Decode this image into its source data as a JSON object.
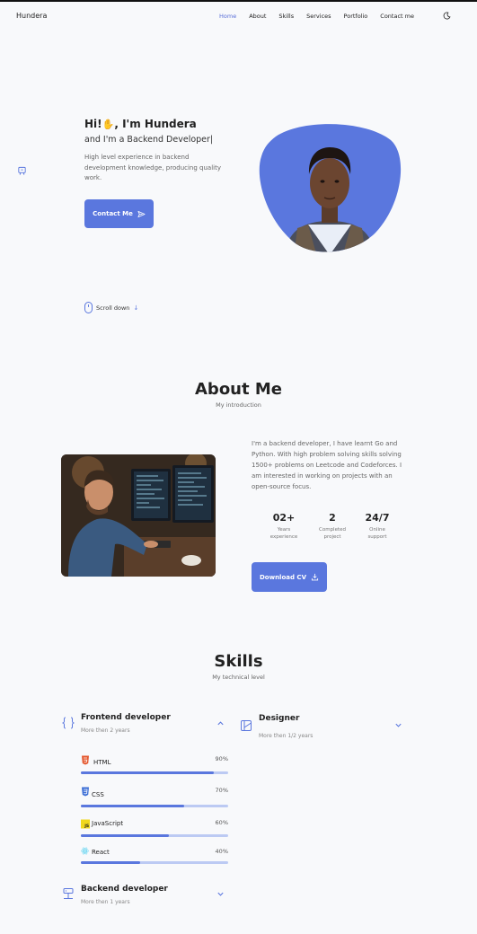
{
  "nav": {
    "brand": "Hundera",
    "links": [
      "Home",
      "About",
      "Skills",
      "Services",
      "Portfolio",
      "Contact me"
    ],
    "active": "Home",
    "theme_icon": "moon-icon"
  },
  "hero": {
    "greeting_prefix": "Hi!",
    "greeting_suffix": ", I'm Hundera",
    "wave_icon": "waving-hand-icon",
    "role": "and I'm a Backend Developer|",
    "description": "High level experience in backend development knowledge, producing quality work.",
    "contact_button": "Contact Me",
    "scroll_label": "Scroll down",
    "accent": "#5a77de"
  },
  "about": {
    "title": "About Me",
    "subtitle": "My introduction",
    "text": "I'm a backend developer, I have learnt Go and Python. With high problem solving skills solving 1500+ problems on Leetcode and Codeforces. I am interested in working on projects with an open-source focus.",
    "stats": [
      {
        "num": "02+",
        "label_1": "Years",
        "label_2": "experience"
      },
      {
        "num": "2",
        "label_1": "Completed",
        "label_2": "project"
      },
      {
        "num": "24/7",
        "label_1": "Online",
        "label_2": "support"
      }
    ],
    "cv_button": "Download CV"
  },
  "skills": {
    "title": "Skills",
    "subtitle": "My technical level",
    "frontend": {
      "title": "Frontend developer",
      "sub": "More then 2 years",
      "items": [
        {
          "name": "HTML",
          "percent": "90%",
          "level": 0.9
        },
        {
          "name": "CSS",
          "percent": "70%",
          "level": 0.7
        },
        {
          "name": "JavaScript",
          "percent": "60%",
          "level": 0.6
        },
        {
          "name": "React",
          "percent": "40%",
          "level": 0.4
        }
      ]
    },
    "designer": {
      "title": "Designer",
      "sub": "More then 1/2 years"
    },
    "backend": {
      "title": "Backend developer",
      "sub": "More then 1 years"
    }
  }
}
